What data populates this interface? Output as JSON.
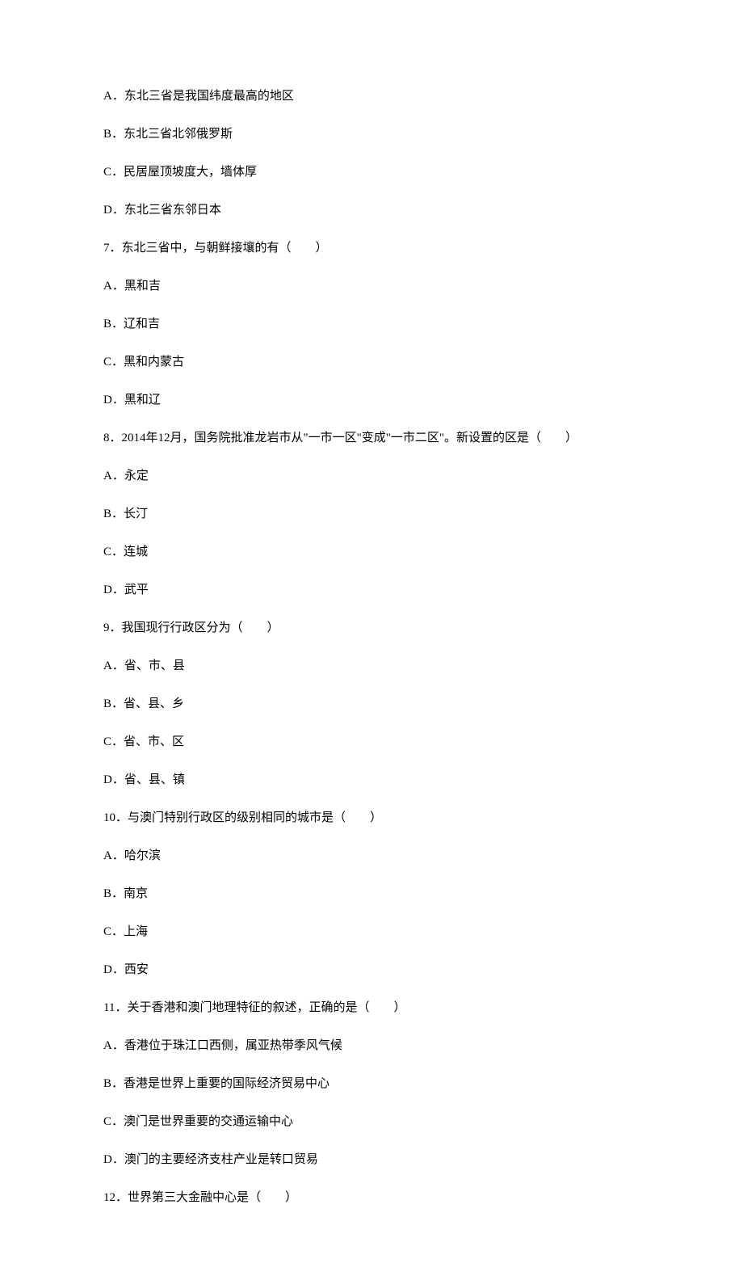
{
  "lines": [
    "A．东北三省是我国纬度最高的地区",
    "B．东北三省北邻俄罗斯",
    "C．民居屋顶坡度大，墙体厚",
    "D．东北三省东邻日本",
    "7．东北三省中，与朝鲜接壤的有（　　）",
    "A．黑和吉",
    "B．辽和吉",
    "C．黑和内蒙古",
    "D．黑和辽",
    "8．2014年12月，国务院批准龙岩市从\"一市一区\"变成\"一市二区\"。新设置的区是（　　）",
    "A．永定",
    "B．长汀",
    "C．连城",
    "D．武平",
    "9．我国现行行政区分为（　　）",
    "A．省、市、县",
    "B．省、县、乡",
    "C．省、市、区",
    "D．省、县、镇",
    "10．与澳门特别行政区的级别相同的城市是（　　）",
    "A．哈尔滨",
    "B．南京",
    "C．上海",
    "D．西安",
    "11．关于香港和澳门地理特征的叙述，正确的是（　　）",
    "A．香港位于珠江口西侧，属亚热带季风气候",
    "B．香港是世界上重要的国际经济贸易中心",
    "C．澳门是世界重要的交通运输中心",
    "D．澳门的主要经济支柱产业是转口贸易",
    "12．世界第三大金融中心是（　　）"
  ]
}
